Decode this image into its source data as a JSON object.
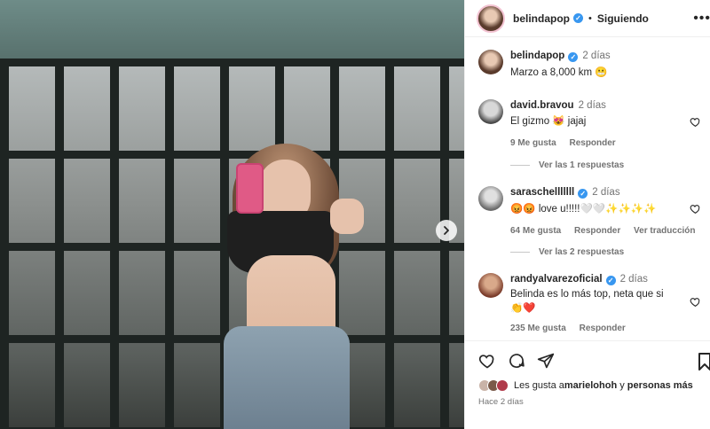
{
  "header": {
    "username": "belindapop",
    "separator": "•",
    "follow_label": "Siguiendo",
    "more_label": "•••"
  },
  "caption": {
    "username": "belindapop",
    "time": "2 días",
    "text": "Marzo a 8,000 km 😬"
  },
  "comments": [
    {
      "username": "david.bravou",
      "time": "2 días",
      "text": "El gizmo 😻 jajaj",
      "likes": "9 Me gusta",
      "reply_label": "Responder",
      "view_replies": "Ver las 1 respuestas"
    },
    {
      "username": "saraschelllllll",
      "verified": true,
      "time": "2 días",
      "text": "😡😡 love u!!!!!🤍🤍✨✨✨✨",
      "likes": "64 Me gusta",
      "reply_label": "Responder",
      "translation_label": "Ver traducción",
      "view_replies": "Ver las 2 respuestas"
    },
    {
      "username": "randyalvarezoficial",
      "verified": true,
      "time": "2 días",
      "text": "Belinda es lo más top, neta que si",
      "text2": "👏❤️",
      "likes": "235 Me gusta",
      "reply_label": "Responder"
    }
  ],
  "likes_line": {
    "prefix": "Les gusta a ",
    "user": "marielohoh",
    "middle": " y ",
    "rest": "personas más"
  },
  "posted_ago": "Hace 2 días",
  "colors": {
    "verified": "#3897f0",
    "meta_gray": "#737373",
    "text": "#262626"
  }
}
